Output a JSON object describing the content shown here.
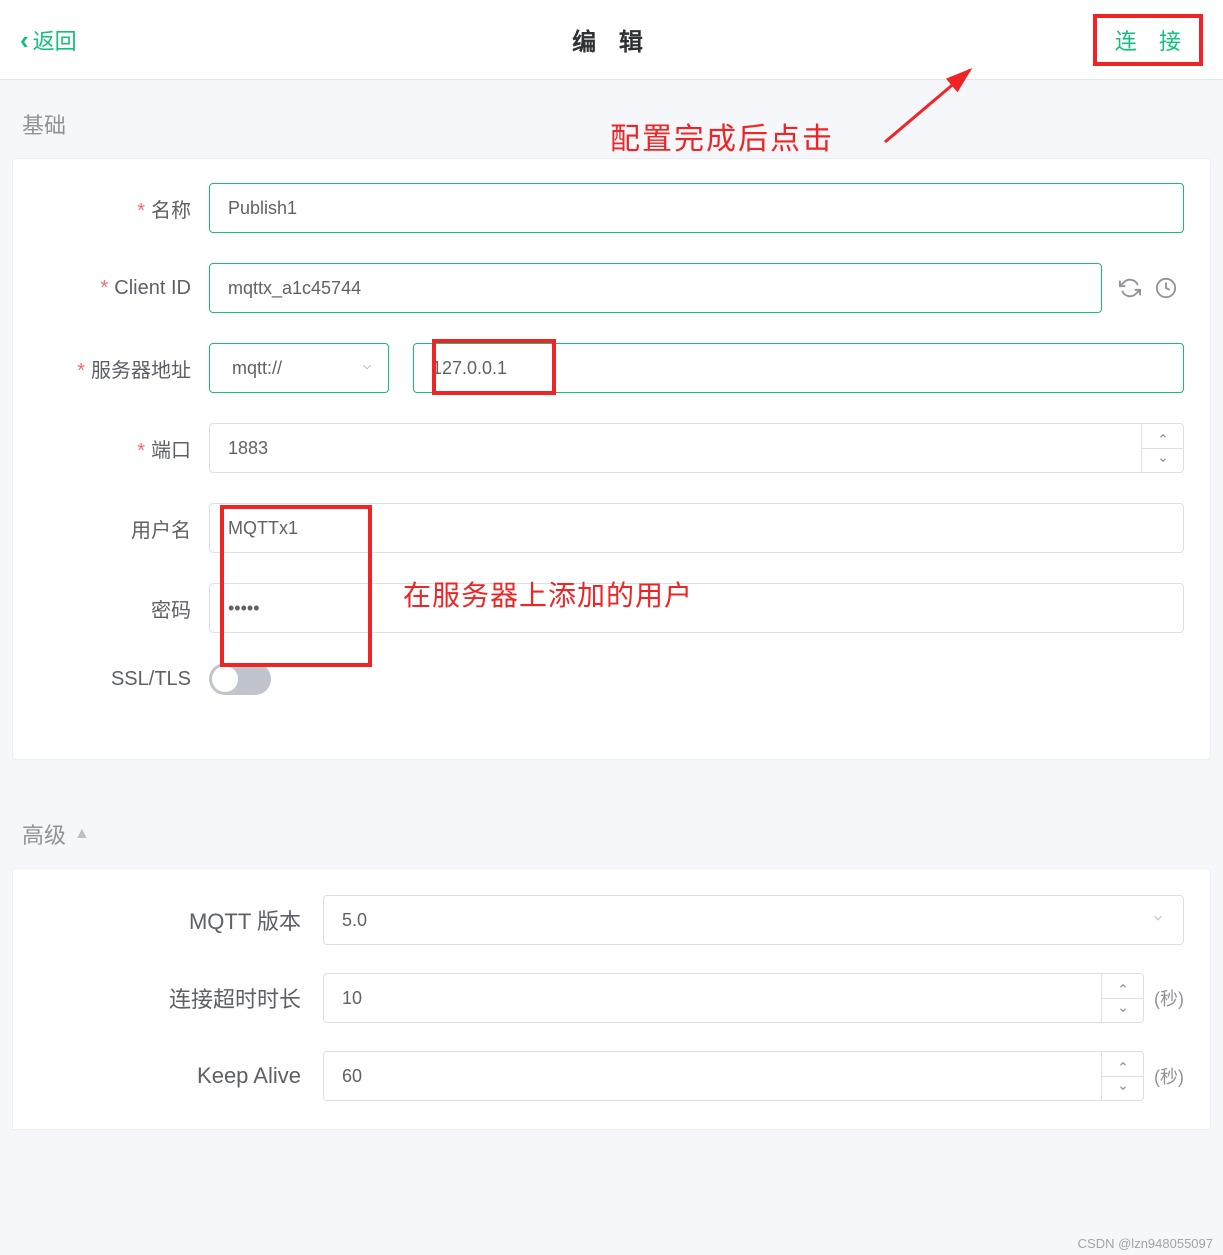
{
  "header": {
    "back": "返回",
    "title": "编 辑",
    "connect": "连 接"
  },
  "annotations": {
    "click_after_config": "配置完成后点击",
    "user_added_on_server": "在服务器上添加的用户"
  },
  "sections": {
    "basic": "基础",
    "advanced": "高级"
  },
  "form": {
    "name": {
      "label": "名称",
      "value": "Publish1"
    },
    "client_id": {
      "label": "Client ID",
      "value": "mqttx_a1c45744"
    },
    "server": {
      "label": "服务器地址",
      "protocol": "mqtt://",
      "host": "127.0.0.1"
    },
    "port": {
      "label": "端口",
      "value": "1883"
    },
    "username": {
      "label": "用户名",
      "value": "MQTTx1"
    },
    "password": {
      "label": "密码",
      "value": "•••••"
    },
    "ssl": {
      "label": "SSL/TLS"
    }
  },
  "advanced": {
    "mqtt_version": {
      "label": "MQTT 版本",
      "value": "5.0"
    },
    "connect_timeout": {
      "label": "连接超时时长",
      "value": "10",
      "unit": "(秒)"
    },
    "keep_alive": {
      "label": "Keep Alive",
      "value": "60",
      "unit": "(秒)"
    }
  },
  "watermark": "CSDN @lzn948055097"
}
